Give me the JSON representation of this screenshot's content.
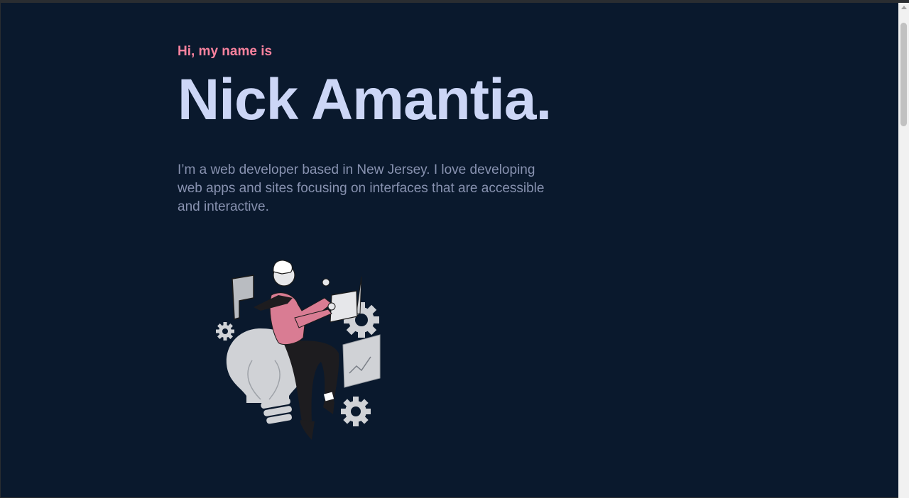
{
  "hero": {
    "greeting": "Hi, my name is",
    "name": "Nick Amantia.",
    "bio": "I’m a web developer based in New Jersey. I love developing web apps and sites focusing on interfaces that are accessible and interactive."
  },
  "illustration": {
    "icon": "developer-with-laptop-lightbulb-gears-illustration"
  },
  "colors": {
    "background": "#0a192d",
    "accent": "#f9829e",
    "heading": "#ccd6f6",
    "body_text": "#8892b0"
  }
}
